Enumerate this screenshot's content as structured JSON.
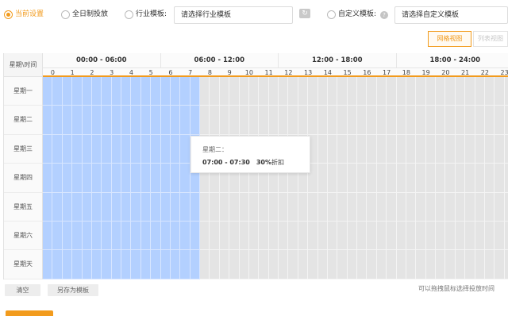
{
  "options": {
    "current": "当前设置",
    "all_day": "全日制投放",
    "industry_label": "行业模板:",
    "industry_placeholder": "请选择行业模板",
    "custom_label": "自定义模板:",
    "custom_placeholder": "请选择自定义模板",
    "help": "?"
  },
  "view": {
    "grid": "网格视图",
    "list": "列表视图"
  },
  "grid": {
    "corner": "星期\\时间",
    "ranges": [
      "00:00 - 06:00",
      "06:00 - 12:00",
      "12:00 - 18:00",
      "18:00 - 24:00"
    ],
    "hours": [
      "0",
      "1",
      "2",
      "3",
      "4",
      "5",
      "6",
      "7",
      "8",
      "9",
      "10",
      "11",
      "12",
      "13",
      "14",
      "15",
      "16",
      "17",
      "18",
      "19",
      "20",
      "21",
      "22",
      "23"
    ],
    "days": [
      "星期一",
      "星期二",
      "星期三",
      "星期四",
      "星期五",
      "星期六",
      "星期天"
    ],
    "selected_hours": [
      0,
      1,
      2,
      3,
      4,
      5,
      6,
      7
    ]
  },
  "tooltip": {
    "title": "星期二：",
    "time": "07:00 - 07:30",
    "discount": "30%",
    "discount_suffix": "折扣"
  },
  "actions": {
    "clear": "清空",
    "save_template": "另存为模板"
  },
  "hint": "可以拖拽鼠标选择投放时间",
  "colors": {
    "accent": "#f29b1d",
    "selected": "#b3d0ff",
    "unselected": "#e4e4e4"
  }
}
